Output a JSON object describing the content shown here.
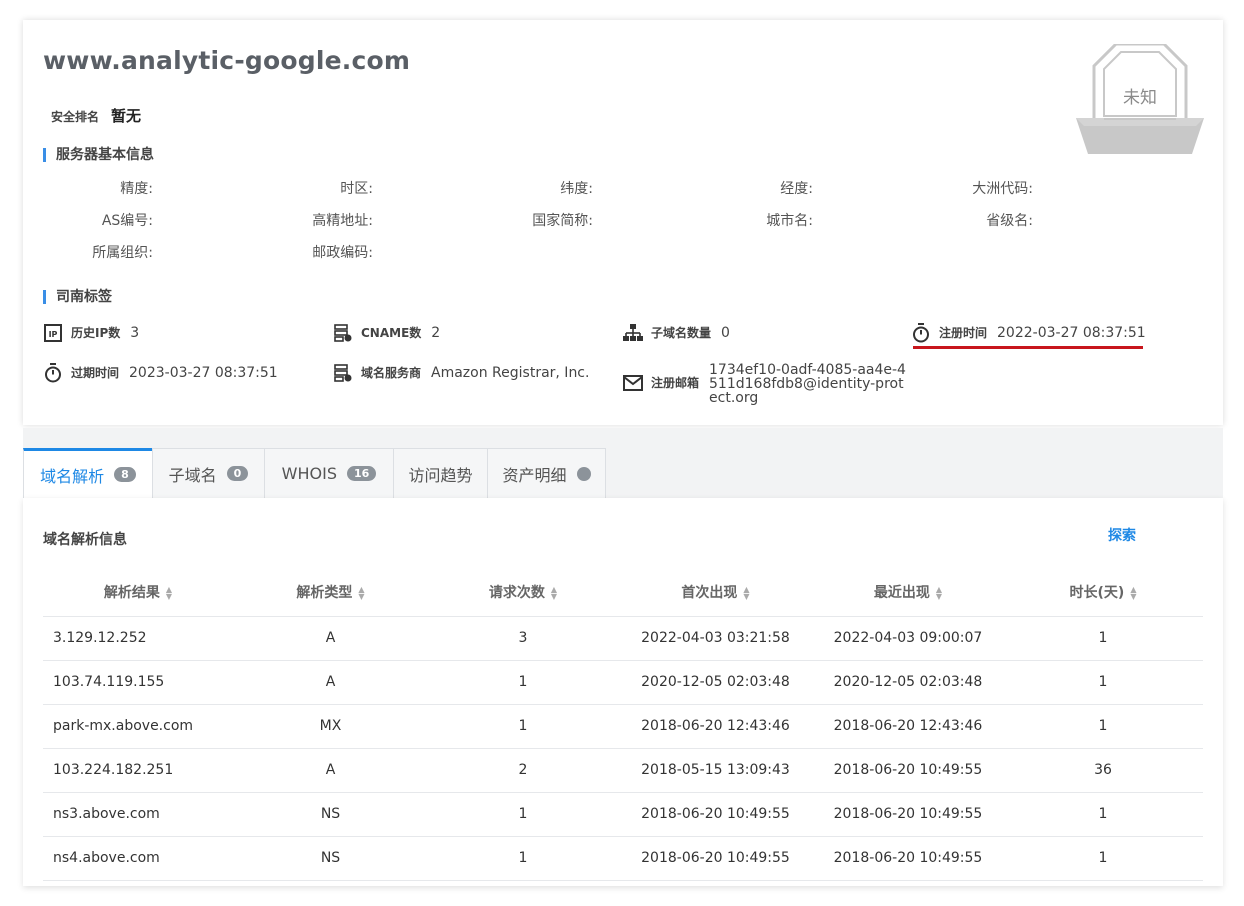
{
  "header": {
    "domain": "www.analytic-google.com",
    "rank_label": "安全排名",
    "rank_value": "暂无",
    "badge_text": "未知"
  },
  "server_info": {
    "section_title": "服务器基本信息",
    "fields": [
      "精度:",
      "时区:",
      "纬度:",
      "经度:",
      "大洲代码:",
      "AS编号:",
      "高精地址:",
      "国家简称:",
      "城市名:",
      "省级名:",
      "所属组织:",
      "邮政编码:"
    ]
  },
  "tags": {
    "section_title": "司南标签",
    "items": [
      {
        "icon": "ip-icon",
        "label": "历史IP数",
        "value": "3"
      },
      {
        "icon": "server-icon",
        "label": "CNAME数",
        "value": "2"
      },
      {
        "icon": "sitemap-icon",
        "label": "子域名数量",
        "value": "0"
      },
      {
        "icon": "stopwatch-icon",
        "label": "注册时间",
        "value": "2022-03-27 08:37:51"
      },
      {
        "icon": "stopwatch-icon",
        "label": "过期时间",
        "value": "2023-03-27 08:37:51"
      },
      {
        "icon": "server-icon",
        "label": "域名服务商",
        "value": "Amazon Registrar, Inc."
      },
      {
        "icon": "envelope-icon",
        "label": "注册邮箱",
        "value": "1734ef10-0adf-4085-aa4e-4511d168fdb8@identity-protect.org"
      }
    ]
  },
  "tabs": [
    {
      "label": "域名解析",
      "count": "8",
      "active": true
    },
    {
      "label": "子域名",
      "count": "0",
      "active": false
    },
    {
      "label": "WHOIS",
      "count": "16",
      "active": false
    },
    {
      "label": "访问趋势",
      "count": null,
      "active": false
    },
    {
      "label": "资产明细",
      "count": null,
      "active": false
    }
  ],
  "resolution": {
    "title": "域名解析信息",
    "explore_label": "探索",
    "columns": [
      "解析结果",
      "解析类型",
      "请求次数",
      "首次出现",
      "最近出现",
      "时长(天)"
    ],
    "rows": [
      [
        "3.129.12.252",
        "A",
        "3",
        "2022-04-03 03:21:58",
        "2022-04-03 09:00:07",
        "1"
      ],
      [
        "103.74.119.155",
        "A",
        "1",
        "2020-12-05 02:03:48",
        "2020-12-05 02:03:48",
        "1"
      ],
      [
        "park-mx.above.com",
        "MX",
        "1",
        "2018-06-20 12:43:46",
        "2018-06-20 12:43:46",
        "1"
      ],
      [
        "103.224.182.251",
        "A",
        "2",
        "2018-05-15 13:09:43",
        "2018-06-20 10:49:55",
        "36"
      ],
      [
        "ns3.above.com",
        "NS",
        "1",
        "2018-06-20 10:49:55",
        "2018-06-20 10:49:55",
        "1"
      ],
      [
        "ns4.above.com",
        "NS",
        "1",
        "2018-06-20 10:49:55",
        "2018-06-20 10:49:55",
        "1"
      ]
    ]
  },
  "colors": {
    "accent": "#1e88e5",
    "highlight_underline": "#c8161d",
    "badge_gray": "#c8c8c8"
  }
}
